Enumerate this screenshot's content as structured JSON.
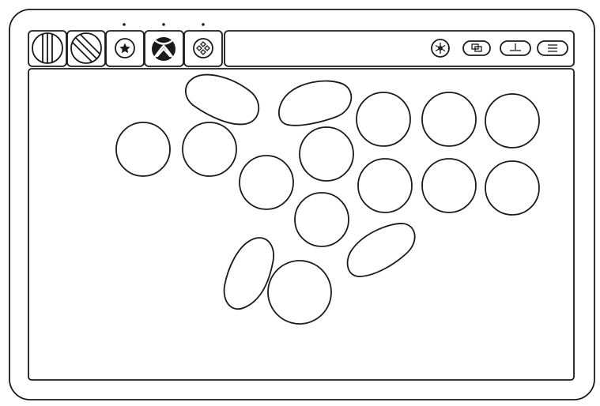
{
  "device": {
    "mode_tabs": [
      {
        "id": "mode-1",
        "icon": "vertical-lines-icon",
        "active": false
      },
      {
        "id": "mode-2",
        "icon": "slash-circle-icon",
        "active": false
      },
      {
        "id": "mode-3",
        "icon": "star-icon",
        "active": false
      },
      {
        "id": "mode-4",
        "icon": "xbox-logo-icon",
        "active": true
      },
      {
        "id": "mode-5",
        "icon": "dpad-diamond-icon",
        "active": false
      }
    ],
    "system_buttons": [
      {
        "id": "guide",
        "icon": "snowflake-icon"
      },
      {
        "id": "view",
        "icon": "view-windows-icon"
      },
      {
        "id": "share",
        "icon": "share-tray-icon"
      },
      {
        "id": "menu",
        "icon": "hamburger-menu-icon"
      }
    ],
    "action_buttons": [
      {
        "id": "bean-top-left",
        "shape": "bean"
      },
      {
        "id": "bean-top-right",
        "shape": "bean"
      },
      {
        "id": "round-left",
        "shape": "circle"
      },
      {
        "id": "round-left-2",
        "shape": "circle"
      },
      {
        "id": "round-mid-upper",
        "shape": "circle"
      },
      {
        "id": "round-mid-lower",
        "shape": "circle"
      },
      {
        "id": "round-center",
        "shape": "circle"
      },
      {
        "id": "round-center-low",
        "shape": "circle"
      },
      {
        "id": "face-1",
        "shape": "circle"
      },
      {
        "id": "face-2",
        "shape": "circle"
      },
      {
        "id": "face-3",
        "shape": "circle"
      },
      {
        "id": "face-4",
        "shape": "circle"
      },
      {
        "id": "face-5",
        "shape": "circle"
      },
      {
        "id": "face-6",
        "shape": "circle"
      },
      {
        "id": "bean-bottom-left",
        "shape": "bean"
      },
      {
        "id": "thumb-large",
        "shape": "circle"
      },
      {
        "id": "bean-bottom-right",
        "shape": "bean"
      }
    ]
  }
}
